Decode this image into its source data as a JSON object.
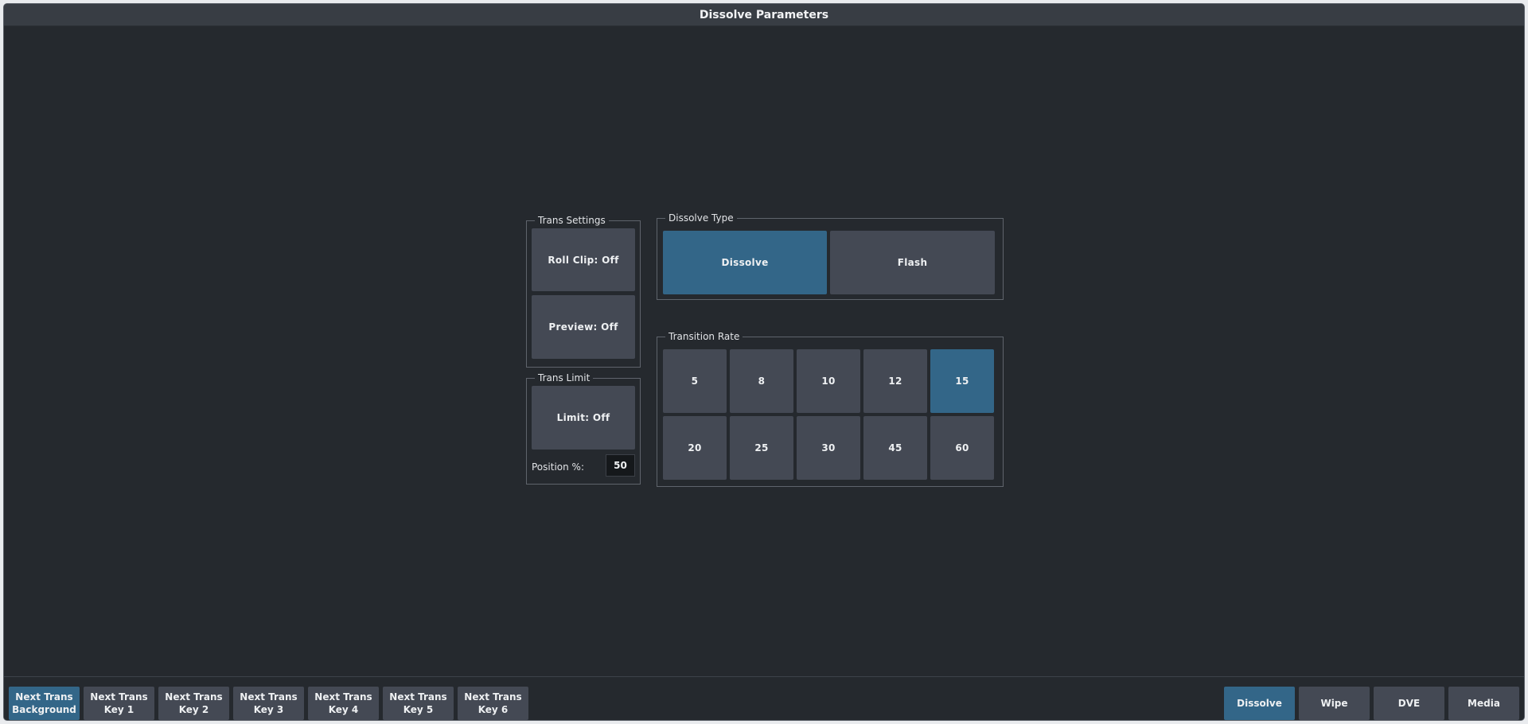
{
  "window": {
    "title": "Dissolve Parameters"
  },
  "trans_settings": {
    "legend": "Trans Settings",
    "roll_clip": "Roll Clip: Off",
    "preview": "Preview: Off"
  },
  "trans_limit": {
    "legend": "Trans Limit",
    "limit": "Limit: Off",
    "position_label": "Position %:",
    "position_value": "50"
  },
  "dissolve_type": {
    "legend": "Dissolve Type",
    "options": [
      "Dissolve",
      "Flash"
    ],
    "selected": "Dissolve"
  },
  "transition_rate": {
    "legend": "Transition Rate",
    "rates": [
      "5",
      "8",
      "10",
      "12",
      "15",
      "20",
      "25",
      "30",
      "45",
      "60"
    ],
    "selected": "15"
  },
  "next_trans": [
    {
      "line1": "Next Trans",
      "line2": "Background",
      "active": true
    },
    {
      "line1": "Next Trans",
      "line2": "Key 1",
      "active": false
    },
    {
      "line1": "Next Trans",
      "line2": "Key 2",
      "active": false
    },
    {
      "line1": "Next Trans",
      "line2": "Key 3",
      "active": false
    },
    {
      "line1": "Next Trans",
      "line2": "Key 4",
      "active": false
    },
    {
      "line1": "Next Trans",
      "line2": "Key 5",
      "active": false
    },
    {
      "line1": "Next Trans",
      "line2": "Key 6",
      "active": false
    }
  ],
  "transition_tabs": [
    {
      "label": "Dissolve",
      "active": true
    },
    {
      "label": "Wipe",
      "active": false
    },
    {
      "label": "DVE",
      "active": false
    },
    {
      "label": "Media",
      "active": false
    }
  ],
  "colors": {
    "accent": "#336688",
    "button": "#444954",
    "background": "#25292e"
  }
}
